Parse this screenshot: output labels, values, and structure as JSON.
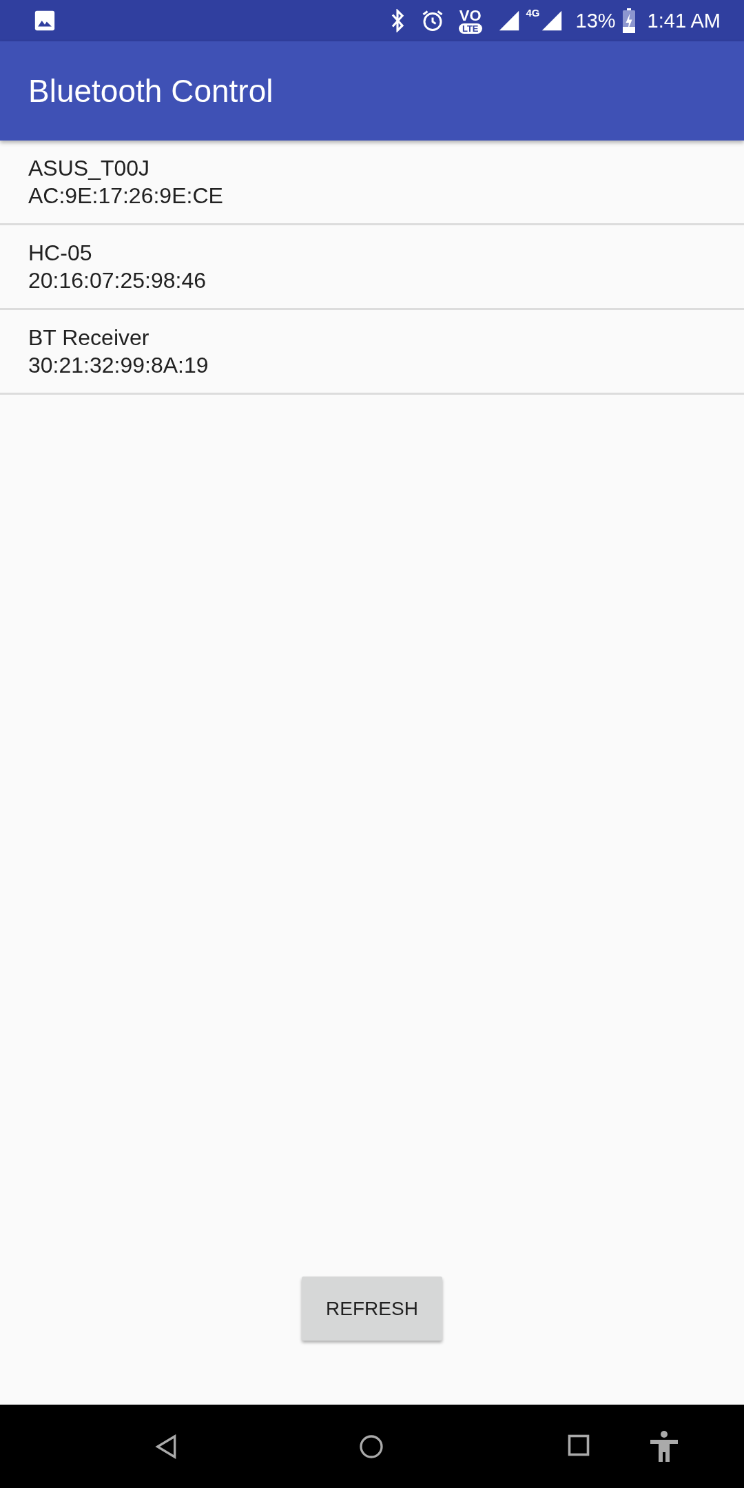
{
  "status_bar": {
    "volte": [
      "VO",
      "LTE"
    ],
    "network": "4G",
    "battery": "13%",
    "time": "1:41 AM"
  },
  "app_bar": {
    "title": "Bluetooth Control"
  },
  "devices": [
    {
      "name": "ASUS_T00J",
      "address": "AC:9E:17:26:9E:CE"
    },
    {
      "name": "HC-05",
      "address": "20:16:07:25:98:46"
    },
    {
      "name": "BT Receiver",
      "address": "30:21:32:99:8A:19"
    }
  ],
  "buttons": [
    "REFRESH"
  ]
}
